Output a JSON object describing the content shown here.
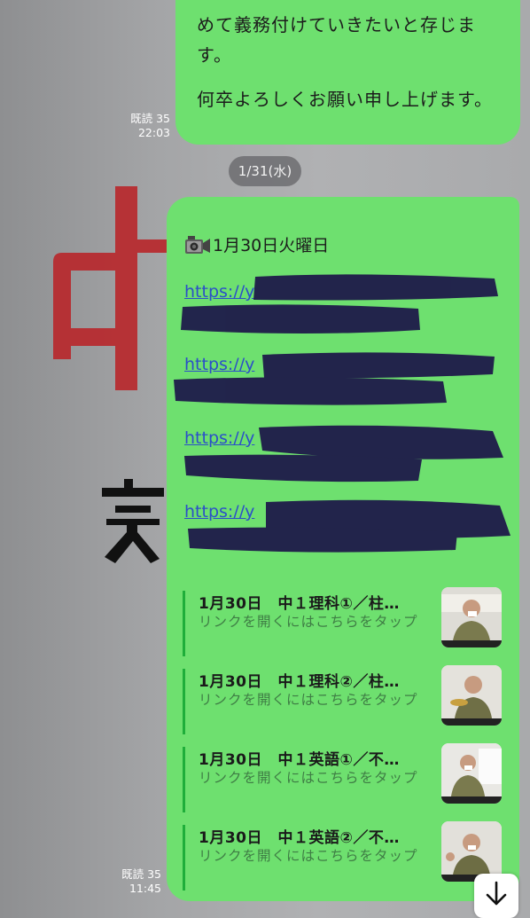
{
  "top_message": {
    "lines": [
      "めて義務付けていきたいと存じます。",
      "何卒よろしくお願い申し上げます。"
    ],
    "line_1a": "めて義務付けていきたいと存じま",
    "line_1b": "す。",
    "line_2": "何卒よろしくお願い申し上げます。",
    "read_label": "既読 35",
    "time": "22:03"
  },
  "date_separator": "1/31(水)",
  "main_message": {
    "icon": "video-camera-icon",
    "heading": "1月30日火曜日",
    "links": [
      "https://y",
      "https://y",
      "https://y",
      "https://y"
    ],
    "previews": [
      {
        "title": "1月30日　中１理科①／柱…",
        "subtitle": "リンクを開くにはこちらをタップ"
      },
      {
        "title": "1月30日　中１理科②／柱…",
        "subtitle": "リンクを開くにはこちらをタップ"
      },
      {
        "title": "1月30日　中１英語①／不…",
        "subtitle": "リンクを開くにはこちらをタップ"
      },
      {
        "title": "1月30日　中１英語②／不…",
        "subtitle": "リンクを開くにはこちらをタップ"
      }
    ],
    "read_label": "既読 35",
    "time": "11:45"
  },
  "colors": {
    "bubble": "#6ee06f",
    "link": "#2b4fc9",
    "preview_bar": "#1fae3a",
    "preview_sub": "#3f7e45",
    "redaction": "#1e1a4a"
  },
  "scroll_button_icon": "arrow-down-icon"
}
